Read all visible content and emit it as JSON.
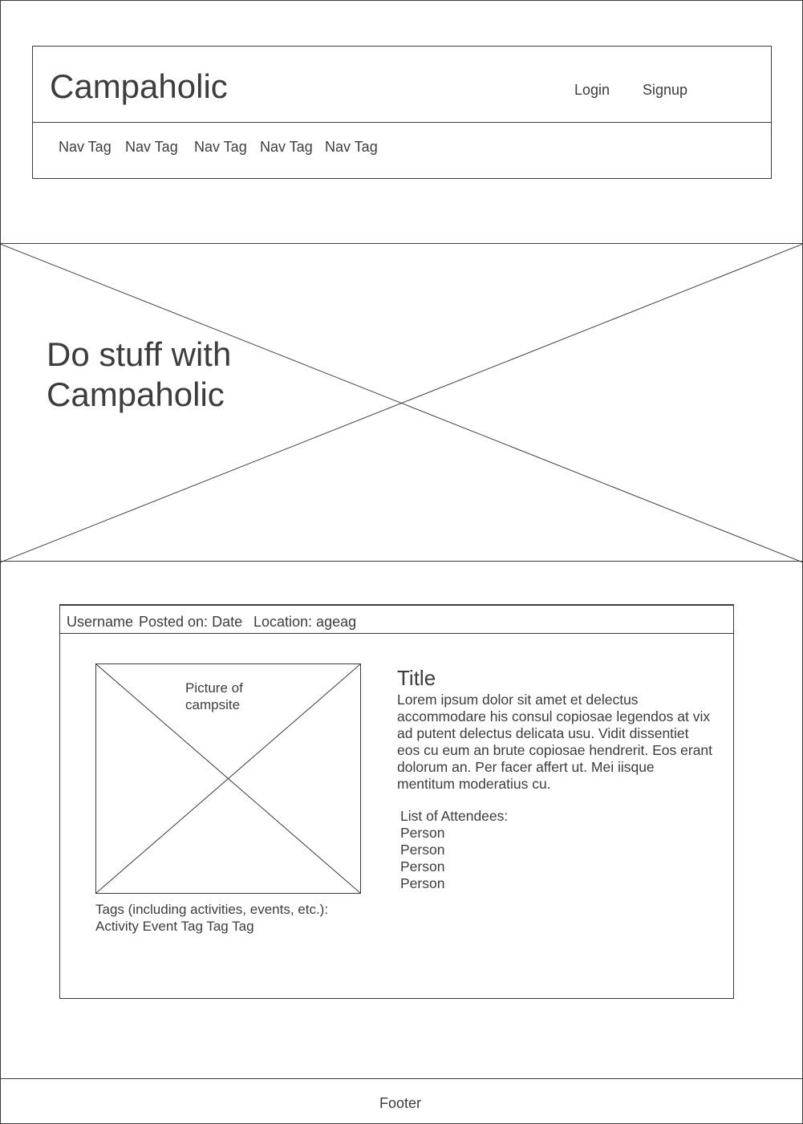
{
  "header": {
    "brand": "Campaholic",
    "login_label": "Login",
    "signup_label": "Signup",
    "nav_tags": [
      "Nav Tag",
      "Nav Tag",
      "Nav Tag",
      "Nav Tag",
      "Nav Tag"
    ]
  },
  "hero": {
    "line1": "Do stuff with",
    "line2": "Campaholic"
  },
  "post": {
    "username": "Username",
    "posted_on": "Posted on: Date",
    "location": "Location: ageag",
    "photo_label": "Picture of campsite",
    "tags_label": "Tags (including activities, events, etc.):",
    "tags": [
      "Activity",
      "Event",
      "Tag",
      "Tag",
      "Tag"
    ],
    "title": "Title",
    "body": "Lorem ipsum dolor sit amet et delectus accommodare his consul copiosae legendos at vix ad putent delectus delicata usu. Vidit dissentiet eos cu eum an brute copiosae hendrerit. Eos erant dolorum an. Per facer affert ut. Mei iisque mentitum moderatius cu.",
    "attendees_label": "List of Attendees:",
    "attendees": [
      "Person",
      "Person",
      "Person",
      "Person"
    ]
  },
  "footer": {
    "text": "Footer"
  }
}
